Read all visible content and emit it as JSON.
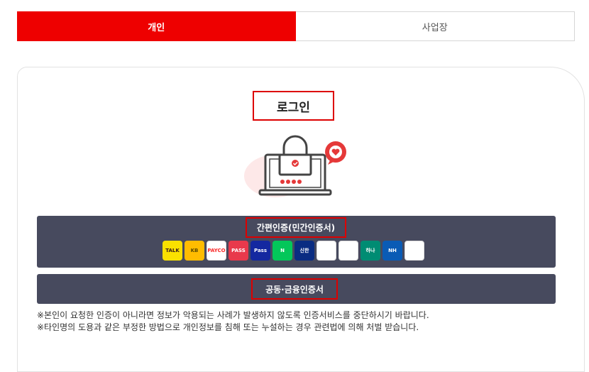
{
  "tabs": [
    {
      "label": "개인",
      "active": true
    },
    {
      "label": "사업장",
      "active": false
    }
  ],
  "login": {
    "title": "로그인"
  },
  "simple_auth": {
    "label": "간편인증(민간인증서)",
    "providers": [
      {
        "name": "kakao-icon",
        "text": "TALK",
        "bg": "#fae100",
        "fg": "#3a1d1d"
      },
      {
        "name": "kb-bank-icon",
        "text": "KB",
        "bg": "#ffbc00",
        "fg": "#5c4a00"
      },
      {
        "name": "payco-icon",
        "text": "PAYCO",
        "bg": "#ffffff",
        "fg": "#fa2828"
      },
      {
        "name": "pass-icon",
        "text": "PASS",
        "bg": "#e8394c",
        "fg": "#ffffff"
      },
      {
        "name": "samsung-pass-icon",
        "text": "Pass",
        "bg": "#1428a0",
        "fg": "#ffffff"
      },
      {
        "name": "naver-icon",
        "text": "N",
        "bg": "#03c75a",
        "fg": "#ffffff"
      },
      {
        "name": "shinhan-icon",
        "text": "신한",
        "bg": "#0a2c82",
        "fg": "#ffffff"
      },
      {
        "name": "toss-icon",
        "text": "",
        "bg": "#ffffff",
        "fg": "#1b64da"
      },
      {
        "name": "banksalad-icon",
        "text": "",
        "bg": "#ffffff",
        "fg": "#18c29c"
      },
      {
        "name": "hana-bank-icon",
        "text": "하나",
        "bg": "#008c73",
        "fg": "#ffffff"
      },
      {
        "name": "nh-bank-icon",
        "text": "NH",
        "bg": "#0a5bb5",
        "fg": "#ffffff"
      },
      {
        "name": "woori-bank-icon",
        "text": "",
        "bg": "#ffffff",
        "fg": "#e1261c"
      }
    ]
  },
  "joint_auth": {
    "label": "공동·금융인증서"
  },
  "notices": [
    "※본인이 요청한 인증이 아니라면 정보가 악용되는 사례가 발생하지 않도록 인증서비스를 중단하시기 바랍니다.",
    "※타인명의 도용과 같은 부정한 방법으로 개인정보를 침해 또는 누설하는 경우 관련법에 의해 처벌 받습니다."
  ],
  "colors": {
    "accent": "#ee0000",
    "button_bg": "#474a5e",
    "highlight_border": "#dd0000"
  }
}
